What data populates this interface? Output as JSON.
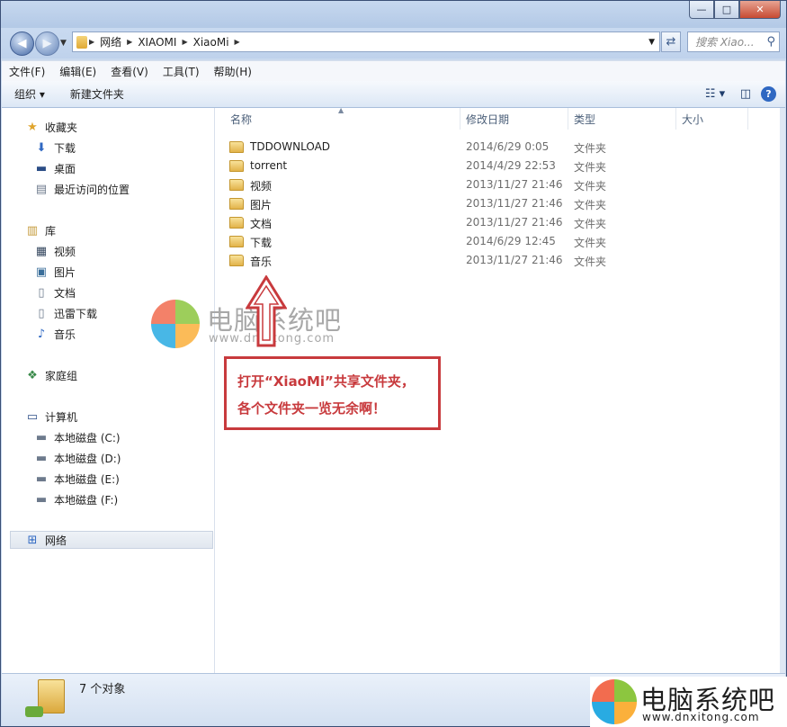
{
  "window": {
    "controls": {
      "minimize": "—",
      "maximize": "□",
      "close": "✕"
    }
  },
  "address_bar": {
    "crumbs": [
      "网络",
      "XIAOMI",
      "XiaoMi"
    ],
    "search_placeholder": "搜索 Xiao..."
  },
  "menu": [
    "文件(F)",
    "编辑(E)",
    "查看(V)",
    "工具(T)",
    "帮助(H)"
  ],
  "toolbar": {
    "organize": "组织 ▾",
    "new_folder": "新建文件夹"
  },
  "sidebar": {
    "favorites": {
      "label": "收藏夹",
      "items": [
        "下载",
        "桌面",
        "最近访问的位置"
      ]
    },
    "libraries": {
      "label": "库",
      "items": [
        "视频",
        "图片",
        "文档",
        "迅雷下载",
        "音乐"
      ]
    },
    "homegroup": "家庭组",
    "computer": {
      "label": "计算机",
      "items": [
        "本地磁盘 (C:)",
        "本地磁盘 (D:)",
        "本地磁盘 (E:)",
        "本地磁盘 (F:)"
      ]
    },
    "network": "网络"
  },
  "columns": {
    "name": "名称",
    "modified": "修改日期",
    "type": "类型",
    "size": "大小"
  },
  "files": [
    {
      "name": "TDDOWNLOAD",
      "date": "2014/6/29 0:05",
      "type": "文件夹"
    },
    {
      "name": "torrent",
      "date": "2014/4/29 22:53",
      "type": "文件夹"
    },
    {
      "name": "视频",
      "date": "2013/11/27 21:46",
      "type": "文件夹"
    },
    {
      "name": "图片",
      "date": "2013/11/27 21:46",
      "type": "文件夹"
    },
    {
      "name": "文档",
      "date": "2013/11/27 21:46",
      "type": "文件夹"
    },
    {
      "name": "下载",
      "date": "2014/6/29 12:45",
      "type": "文件夹"
    },
    {
      "name": "音乐",
      "date": "2013/11/27 21:46",
      "type": "文件夹"
    }
  ],
  "status": {
    "count": "7 个对象"
  },
  "watermark": {
    "name": "电脑系统吧",
    "url": "www.dnxitong.com"
  },
  "annotation": {
    "line1": "打开“XiaoMi”共享文件夹，",
    "line2": "各个文件夹一览无余啊！"
  },
  "brand": {
    "name": "电脑系统吧",
    "url": "www.dnxitong.com"
  },
  "colors": {
    "annotation": "#c83a3d",
    "accent": "#2f68c2"
  }
}
